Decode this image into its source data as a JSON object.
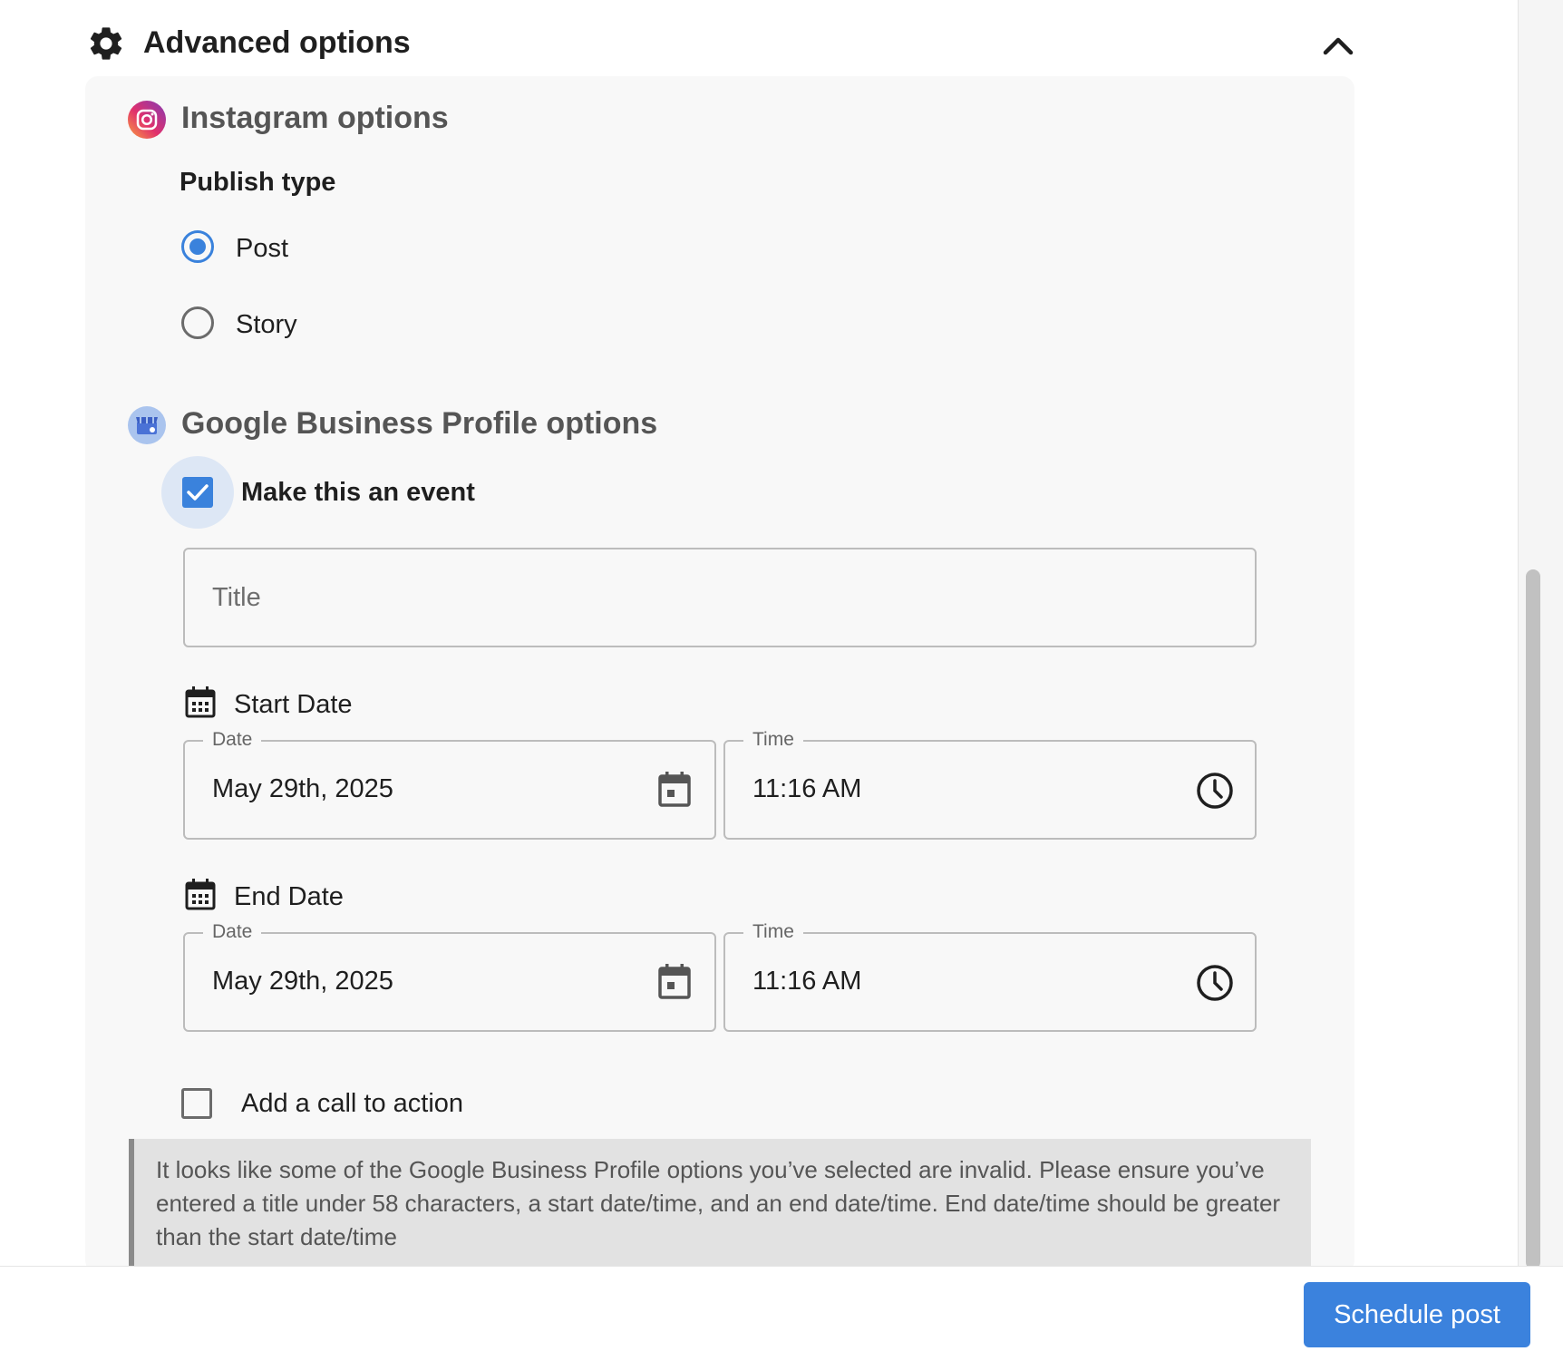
{
  "advanced": {
    "title": "Advanced options",
    "icon": "gear-icon",
    "collapse_icon": "chevron-up-icon"
  },
  "instagram": {
    "title": "Instagram options",
    "icon": "instagram-logo-icon",
    "publish_type_label": "Publish type",
    "options": [
      {
        "label": "Post",
        "selected": true
      },
      {
        "label": "Story",
        "selected": false
      }
    ]
  },
  "gbp": {
    "title": "Google Business Profile options",
    "icon": "google-business-profile-icon",
    "event_label": "Make this an event",
    "event_checked": true,
    "title_field": {
      "placeholder": "Title",
      "value": ""
    },
    "start": {
      "heading": "Start Date",
      "date_legend": "Date",
      "date_value": "May 29th, 2025",
      "time_legend": "Time",
      "time_value": "11:16 AM"
    },
    "end": {
      "heading": "End Date",
      "date_legend": "Date",
      "date_value": "May 29th, 2025",
      "time_legend": "Time",
      "time_value": "11:16 AM"
    },
    "cta_label": "Add a call to action",
    "cta_checked": false,
    "alert_text": "It looks like some of the Google Business Profile options you’ve selected are invalid. Please ensure you’ve entered a title under 58 characters, a start date/time, and an end date/time. End date/time should be greater than the start date/time"
  },
  "footer": {
    "schedule_label": "Schedule post"
  },
  "colors": {
    "accent": "#3a82dc",
    "panel_bg": "#f8f8f8",
    "alert_bg": "#e2e2e2"
  }
}
